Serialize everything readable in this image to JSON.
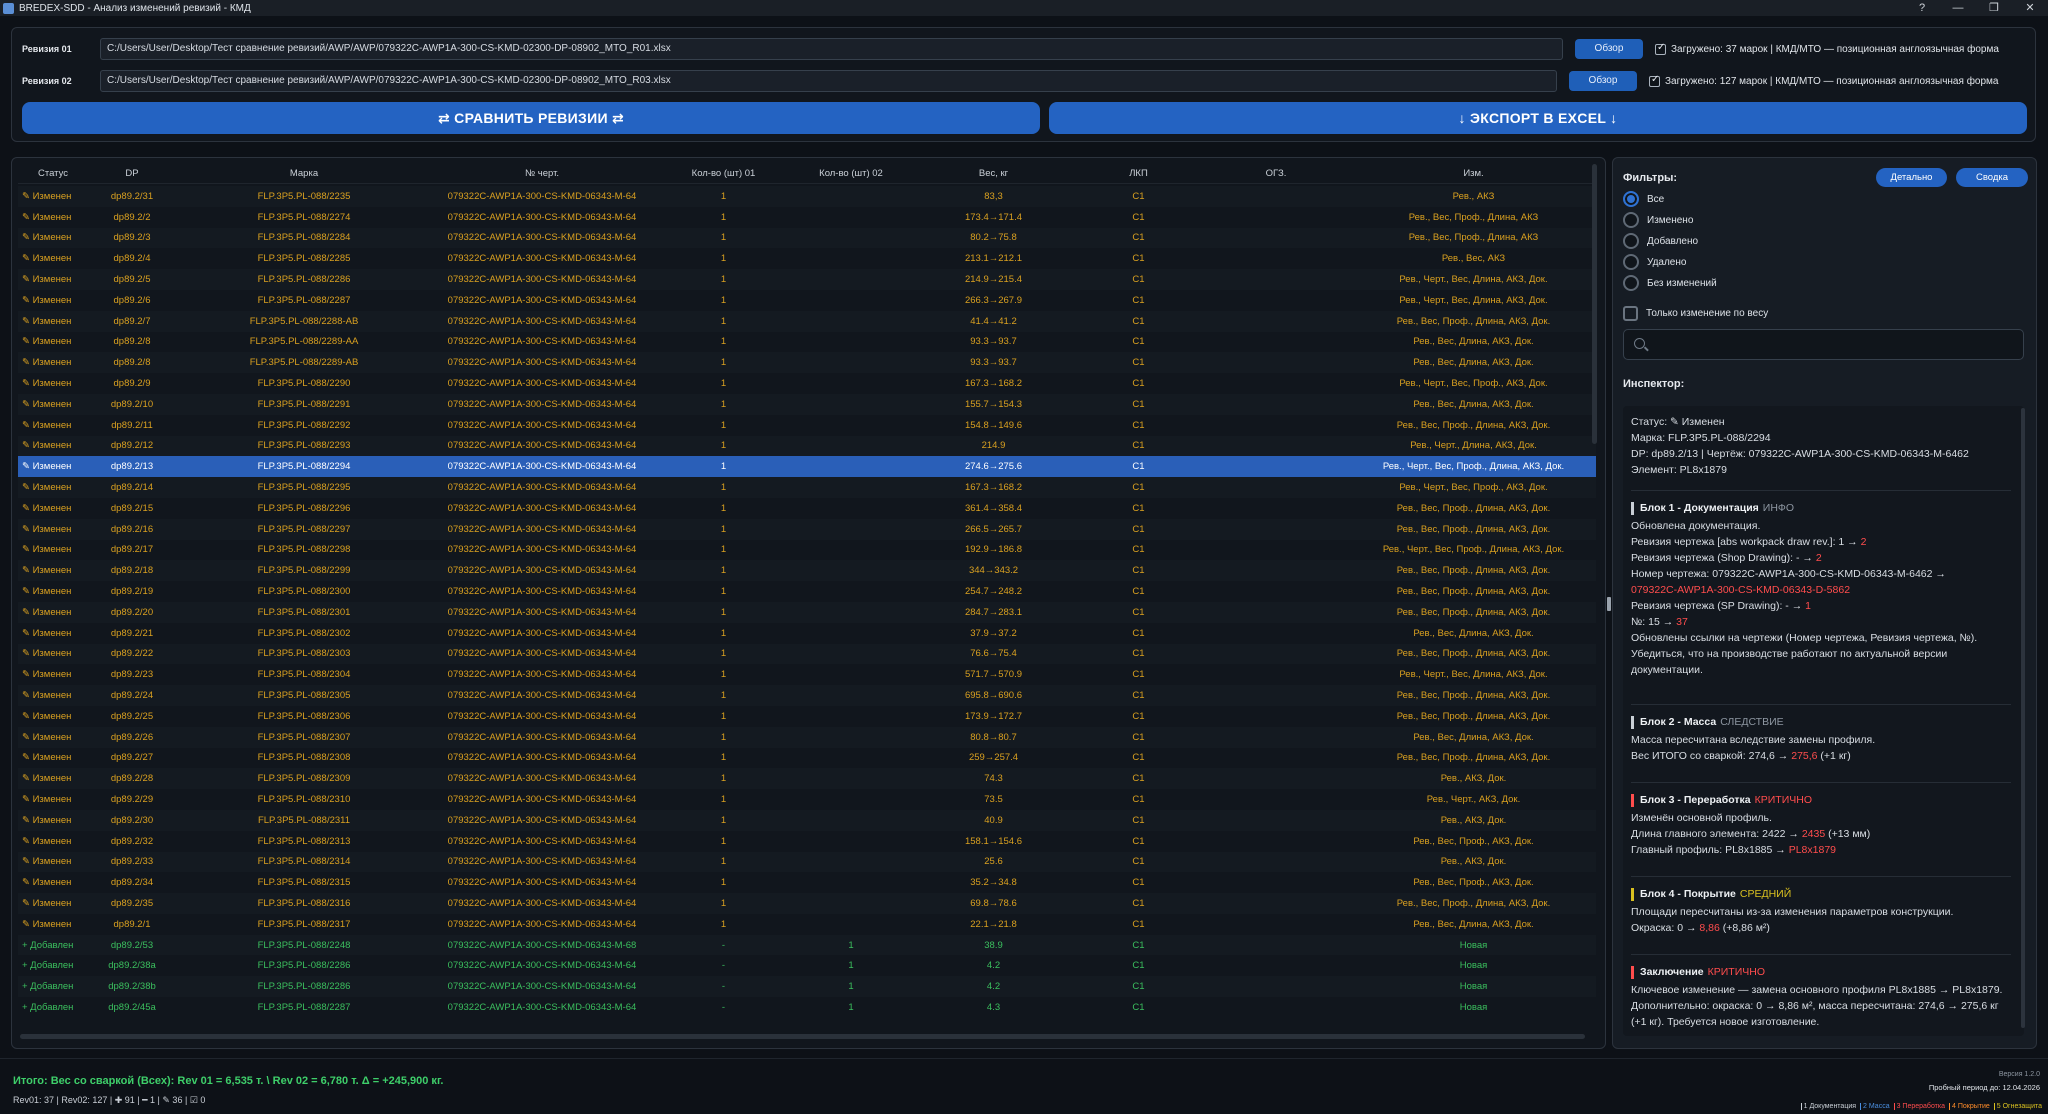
{
  "window": {
    "title": "BREDEX-SDD - Анализ изменений ревизий - КМД",
    "controls": [
      "?",
      "—",
      "❐",
      "✕"
    ]
  },
  "revisions": [
    {
      "label": "Ревизия 01",
      "path": "C:/Users/User/Desktop/Тест сравнение ревизий/AWP/AWP/079322C-AWP1A-300-CS-KMD-02300-DP-08902_MTO_R01.xlsx",
      "browse": "Обзор",
      "loaded": "Загружено: 37 марок | КМД/МТО — позиционная англоязычная форма"
    },
    {
      "label": "Ревизия 02",
      "path": "C:/Users/User/Desktop/Тест сравнение ревизий/AWP/AWP/079322C-AWP1A-300-CS-KMD-02300-DP-08902_MTO_R03.xlsx",
      "browse": "Обзор",
      "loaded": "Загружено: 127 марок | КМД/МТО — позиционная англоязычная форма"
    }
  ],
  "actions": {
    "compare": "⇄   СРАВНИТЬ РЕВИЗИИ   ⇄",
    "export": "↓   ЭКСПОРТ В EXCEL   ↓"
  },
  "table": {
    "headers": [
      "Статус",
      "DP",
      "Марка",
      "№ черт.",
      "Кол-во (шт) 01",
      "Кол-во (шт) 02",
      "Вес, кг",
      "ЛКП",
      "ОГЗ.",
      "Изм."
    ],
    "selected_index": 13,
    "rows": [
      {
        "status": "✎ Изменен",
        "kind": "changed",
        "dp": "dp89.2/31",
        "mark": "FLP.3P5.PL-088/2235",
        "drawing": "079322C-AWP1A-300-CS-KMD-06343-M-64",
        "q1": "1",
        "q2": "",
        "weight": "83,3",
        "lkp": "C1",
        "ogz": "",
        "chg": "Рев., АКЗ"
      },
      {
        "status": "✎ Изменен",
        "kind": "changed",
        "dp": "dp89.2/2",
        "mark": "FLP.3P5.PL-088/2274",
        "drawing": "079322C-AWP1A-300-CS-KMD-06343-M-64",
        "q1": "1",
        "q2": "",
        "weight": "173.4→171.4",
        "lkp": "C1",
        "ogz": "",
        "chg": "Рев., Вес, Проф., Длина, АКЗ"
      },
      {
        "status": "✎ Изменен",
        "kind": "changed",
        "dp": "dp89.2/3",
        "mark": "FLP.3P5.PL-088/2284",
        "drawing": "079322C-AWP1A-300-CS-KMD-06343-M-64",
        "q1": "1",
        "q2": "",
        "weight": "80.2→75.8",
        "lkp": "C1",
        "ogz": "",
        "chg": "Рев., Вес, Проф., Длина, АКЗ"
      },
      {
        "status": "✎ Изменен",
        "kind": "changed",
        "dp": "dp89.2/4",
        "mark": "FLP.3P5.PL-088/2285",
        "drawing": "079322C-AWP1A-300-CS-KMD-06343-M-64",
        "q1": "1",
        "q2": "",
        "weight": "213.1→212.1",
        "lkp": "C1",
        "ogz": "",
        "chg": "Рев., Вес, АКЗ"
      },
      {
        "status": "✎ Изменен",
        "kind": "changed",
        "dp": "dp89.2/5",
        "mark": "FLP.3P5.PL-088/2286",
        "drawing": "079322C-AWP1A-300-CS-KMD-06343-M-64",
        "q1": "1",
        "q2": "",
        "weight": "214.9→215.4",
        "lkp": "C1",
        "ogz": "",
        "chg": "Рев., Черт., Вес, Длина, АКЗ, Док."
      },
      {
        "status": "✎ Изменен",
        "kind": "changed",
        "dp": "dp89.2/6",
        "mark": "FLP.3P5.PL-088/2287",
        "drawing": "079322C-AWP1A-300-CS-KMD-06343-M-64",
        "q1": "1",
        "q2": "",
        "weight": "266.3→267.9",
        "lkp": "C1",
        "ogz": "",
        "chg": "Рев., Черт., Вес, Длина, АКЗ, Док."
      },
      {
        "status": "✎ Изменен",
        "kind": "changed",
        "dp": "dp89.2/7",
        "mark": "FLP.3P5.PL-088/2288-AB",
        "drawing": "079322C-AWP1A-300-CS-KMD-06343-M-64",
        "q1": "1",
        "q2": "",
        "weight": "41.4→41.2",
        "lkp": "C1",
        "ogz": "",
        "chg": "Рев., Вес, Проф., Длина, АКЗ, Док."
      },
      {
        "status": "✎ Изменен",
        "kind": "changed",
        "dp": "dp89.2/8",
        "mark": "FLP.3P5.PL-088/2289-AA",
        "drawing": "079322C-AWP1A-300-CS-KMD-06343-M-64",
        "q1": "1",
        "q2": "",
        "weight": "93.3→93.7",
        "lkp": "C1",
        "ogz": "",
        "chg": "Рев., Вес, Длина, АКЗ, Док."
      },
      {
        "status": "✎ Изменен",
        "kind": "changed",
        "dp": "dp89.2/8",
        "mark": "FLP.3P5.PL-088/2289-AB",
        "drawing": "079322C-AWP1A-300-CS-KMD-06343-M-64",
        "q1": "1",
        "q2": "",
        "weight": "93.3→93.7",
        "lkp": "C1",
        "ogz": "",
        "chg": "Рев., Вес, Длина, АКЗ, Док."
      },
      {
        "status": "✎ Изменен",
        "kind": "changed",
        "dp": "dp89.2/9",
        "mark": "FLP.3P5.PL-088/2290",
        "drawing": "079322C-AWP1A-300-CS-KMD-06343-M-64",
        "q1": "1",
        "q2": "",
        "weight": "167.3→168.2",
        "lkp": "C1",
        "ogz": "",
        "chg": "Рев., Черт., Вес, Проф., АКЗ, Док."
      },
      {
        "status": "✎ Изменен",
        "kind": "changed",
        "dp": "dp89.2/10",
        "mark": "FLP.3P5.PL-088/2291",
        "drawing": "079322C-AWP1A-300-CS-KMD-06343-M-64",
        "q1": "1",
        "q2": "",
        "weight": "155.7→154.3",
        "lkp": "C1",
        "ogz": "",
        "chg": "Рев., Вес, Длина, АКЗ, Док."
      },
      {
        "status": "✎ Изменен",
        "kind": "changed",
        "dp": "dp89.2/11",
        "mark": "FLP.3P5.PL-088/2292",
        "drawing": "079322C-AWP1A-300-CS-KMD-06343-M-64",
        "q1": "1",
        "q2": "",
        "weight": "154.8→149.6",
        "lkp": "C1",
        "ogz": "",
        "chg": "Рев., Вес, Проф., Длина, АКЗ, Док."
      },
      {
        "status": "✎ Изменен",
        "kind": "changed",
        "dp": "dp89.2/12",
        "mark": "FLP.3P5.PL-088/2293",
        "drawing": "079322C-AWP1A-300-CS-KMD-06343-M-64",
        "q1": "1",
        "q2": "",
        "weight": "214.9",
        "lkp": "C1",
        "ogz": "",
        "chg": "Рев., Черт., Длина, АКЗ, Док."
      },
      {
        "status": "✎ Изменен",
        "kind": "changed",
        "dp": "dp89.2/13",
        "mark": "FLP.3P5.PL-088/2294",
        "drawing": "079322C-AWP1A-300-CS-KMD-06343-M-64",
        "q1": "1",
        "q2": "",
        "weight": "274.6→275.6",
        "lkp": "C1",
        "ogz": "",
        "chg": "Рев., Черт., Вес, Проф., Длина, АКЗ, Док."
      },
      {
        "status": "✎ Изменен",
        "kind": "changed",
        "dp": "dp89.2/14",
        "mark": "FLP.3P5.PL-088/2295",
        "drawing": "079322C-AWP1A-300-CS-KMD-06343-M-64",
        "q1": "1",
        "q2": "",
        "weight": "167.3→168.2",
        "lkp": "C1",
        "ogz": "",
        "chg": "Рев., Черт., Вес, Проф., АКЗ, Док."
      },
      {
        "status": "✎ Изменен",
        "kind": "changed",
        "dp": "dp89.2/15",
        "mark": "FLP.3P5.PL-088/2296",
        "drawing": "079322C-AWP1A-300-CS-KMD-06343-M-64",
        "q1": "1",
        "q2": "",
        "weight": "361.4→358.4",
        "lkp": "C1",
        "ogz": "",
        "chg": "Рев., Вес, Проф., Длина, АКЗ, Док."
      },
      {
        "status": "✎ Изменен",
        "kind": "changed",
        "dp": "dp89.2/16",
        "mark": "FLP.3P5.PL-088/2297",
        "drawing": "079322C-AWP1A-300-CS-KMD-06343-M-64",
        "q1": "1",
        "q2": "",
        "weight": "266.5→265.7",
        "lkp": "C1",
        "ogz": "",
        "chg": "Рев., Вес, Проф., Длина, АКЗ, Док."
      },
      {
        "status": "✎ Изменен",
        "kind": "changed",
        "dp": "dp89.2/17",
        "mark": "FLP.3P5.PL-088/2298",
        "drawing": "079322C-AWP1A-300-CS-KMD-06343-M-64",
        "q1": "1",
        "q2": "",
        "weight": "192.9→186.8",
        "lkp": "C1",
        "ogz": "",
        "chg": "Рев., Черт., Вес, Проф., Длина, АКЗ, Док."
      },
      {
        "status": "✎ Изменен",
        "kind": "changed",
        "dp": "dp89.2/18",
        "mark": "FLP.3P5.PL-088/2299",
        "drawing": "079322C-AWP1A-300-CS-KMD-06343-M-64",
        "q1": "1",
        "q2": "",
        "weight": "344→343.2",
        "lkp": "C1",
        "ogz": "",
        "chg": "Рев., Вес, Проф., Длина, АКЗ, Док."
      },
      {
        "status": "✎ Изменен",
        "kind": "changed",
        "dp": "dp89.2/19",
        "mark": "FLP.3P5.PL-088/2300",
        "drawing": "079322C-AWP1A-300-CS-KMD-06343-M-64",
        "q1": "1",
        "q2": "",
        "weight": "254.7→248.2",
        "lkp": "C1",
        "ogz": "",
        "chg": "Рев., Вес, Проф., Длина, АКЗ, Док."
      },
      {
        "status": "✎ Изменен",
        "kind": "changed",
        "dp": "dp89.2/20",
        "mark": "FLP.3P5.PL-088/2301",
        "drawing": "079322C-AWP1A-300-CS-KMD-06343-M-64",
        "q1": "1",
        "q2": "",
        "weight": "284.7→283.1",
        "lkp": "C1",
        "ogz": "",
        "chg": "Рев., Вес, Проф., Длина, АКЗ, Док."
      },
      {
        "status": "✎ Изменен",
        "kind": "changed",
        "dp": "dp89.2/21",
        "mark": "FLP.3P5.PL-088/2302",
        "drawing": "079322C-AWP1A-300-CS-KMD-06343-M-64",
        "q1": "1",
        "q2": "",
        "weight": "37.9→37.2",
        "lkp": "C1",
        "ogz": "",
        "chg": "Рев., Вес, Длина, АКЗ, Док."
      },
      {
        "status": "✎ Изменен",
        "kind": "changed",
        "dp": "dp89.2/22",
        "mark": "FLP.3P5.PL-088/2303",
        "drawing": "079322C-AWP1A-300-CS-KMD-06343-M-64",
        "q1": "1",
        "q2": "",
        "weight": "76.6→75.4",
        "lkp": "C1",
        "ogz": "",
        "chg": "Рев., Вес, Проф., Длина, АКЗ, Док."
      },
      {
        "status": "✎ Изменен",
        "kind": "changed",
        "dp": "dp89.2/23",
        "mark": "FLP.3P5.PL-088/2304",
        "drawing": "079322C-AWP1A-300-CS-KMD-06343-M-64",
        "q1": "1",
        "q2": "",
        "weight": "571.7→570.9",
        "lkp": "C1",
        "ogz": "",
        "chg": "Рев., Черт., Вес, Длина, АКЗ, Док."
      },
      {
        "status": "✎ Изменен",
        "kind": "changed",
        "dp": "dp89.2/24",
        "mark": "FLP.3P5.PL-088/2305",
        "drawing": "079322C-AWP1A-300-CS-KMD-06343-M-64",
        "q1": "1",
        "q2": "",
        "weight": "695.8→690.6",
        "lkp": "C1",
        "ogz": "",
        "chg": "Рев., Вес, Проф., Длина, АКЗ, Док."
      },
      {
        "status": "✎ Изменен",
        "kind": "changed",
        "dp": "dp89.2/25",
        "mark": "FLP.3P5.PL-088/2306",
        "drawing": "079322C-AWP1A-300-CS-KMD-06343-M-64",
        "q1": "1",
        "q2": "",
        "weight": "173.9→172.7",
        "lkp": "C1",
        "ogz": "",
        "chg": "Рев., Вес, Проф., Длина, АКЗ, Док."
      },
      {
        "status": "✎ Изменен",
        "kind": "changed",
        "dp": "dp89.2/26",
        "mark": "FLP.3P5.PL-088/2307",
        "drawing": "079322C-AWP1A-300-CS-KMD-06343-M-64",
        "q1": "1",
        "q2": "",
        "weight": "80.8→80.7",
        "lkp": "C1",
        "ogz": "",
        "chg": "Рев., Вес, Длина, АКЗ, Док."
      },
      {
        "status": "✎ Изменен",
        "kind": "changed",
        "dp": "dp89.2/27",
        "mark": "FLP.3P5.PL-088/2308",
        "drawing": "079322C-AWP1A-300-CS-KMD-06343-M-64",
        "q1": "1",
        "q2": "",
        "weight": "259→257.4",
        "lkp": "C1",
        "ogz": "",
        "chg": "Рев., Вес, Проф., Длина, АКЗ, Док."
      },
      {
        "status": "✎ Изменен",
        "kind": "changed",
        "dp": "dp89.2/28",
        "mark": "FLP.3P5.PL-088/2309",
        "drawing": "079322C-AWP1A-300-CS-KMD-06343-M-64",
        "q1": "1",
        "q2": "",
        "weight": "74.3",
        "lkp": "C1",
        "ogz": "",
        "chg": "Рев., АКЗ, Док."
      },
      {
        "status": "✎ Изменен",
        "kind": "changed",
        "dp": "dp89.2/29",
        "mark": "FLP.3P5.PL-088/2310",
        "drawing": "079322C-AWP1A-300-CS-KMD-06343-M-64",
        "q1": "1",
        "q2": "",
        "weight": "73.5",
        "lkp": "C1",
        "ogz": "",
        "chg": "Рев., Черт., АКЗ, Док."
      },
      {
        "status": "✎ Изменен",
        "kind": "changed",
        "dp": "dp89.2/30",
        "mark": "FLP.3P5.PL-088/2311",
        "drawing": "079322C-AWP1A-300-CS-KMD-06343-M-64",
        "q1": "1",
        "q2": "",
        "weight": "40.9",
        "lkp": "C1",
        "ogz": "",
        "chg": "Рев., АКЗ, Док."
      },
      {
        "status": "✎ Изменен",
        "kind": "changed",
        "dp": "dp89.2/32",
        "mark": "FLP.3P5.PL-088/2313",
        "drawing": "079322C-AWP1A-300-CS-KMD-06343-M-64",
        "q1": "1",
        "q2": "",
        "weight": "158.1→154.6",
        "lkp": "C1",
        "ogz": "",
        "chg": "Рев., Вес, Проф., АКЗ, Док."
      },
      {
        "status": "✎ Изменен",
        "kind": "changed",
        "dp": "dp89.2/33",
        "mark": "FLP.3P5.PL-088/2314",
        "drawing": "079322C-AWP1A-300-CS-KMD-06343-M-64",
        "q1": "1",
        "q2": "",
        "weight": "25.6",
        "lkp": "C1",
        "ogz": "",
        "chg": "Рев., АКЗ, Док."
      },
      {
        "status": "✎ Изменен",
        "kind": "changed",
        "dp": "dp89.2/34",
        "mark": "FLP.3P5.PL-088/2315",
        "drawing": "079322C-AWP1A-300-CS-KMD-06343-M-64",
        "q1": "1",
        "q2": "",
        "weight": "35.2→34.8",
        "lkp": "C1",
        "ogz": "",
        "chg": "Рев., Вес, Проф., АКЗ, Док."
      },
      {
        "status": "✎ Изменен",
        "kind": "changed",
        "dp": "dp89.2/35",
        "mark": "FLP.3P5.PL-088/2316",
        "drawing": "079322C-AWP1A-300-CS-KMD-06343-M-64",
        "q1": "1",
        "q2": "",
        "weight": "69.8→78.6",
        "lkp": "C1",
        "ogz": "",
        "chg": "Рев., Вес, Проф., Длина, АКЗ, Док."
      },
      {
        "status": "✎ Изменен",
        "kind": "changed",
        "dp": "dp89.2/1",
        "mark": "FLP.3P5.PL-088/2317",
        "drawing": "079322C-AWP1A-300-CS-KMD-06343-M-64",
        "q1": "1",
        "q2": "",
        "weight": "22.1→21.8",
        "lkp": "C1",
        "ogz": "",
        "chg": "Рев., Вес, Длина, АКЗ, Док."
      },
      {
        "status": "+ Добавлен",
        "kind": "added",
        "dp": "dp89.2/53",
        "mark": "FLP.3P5.PL-088/2248",
        "drawing": "079322C-AWP1A-300-CS-KMD-06343-M-68",
        "q1": "-",
        "q2": "1",
        "weight": "38.9",
        "lkp": "C1",
        "ogz": "",
        "chg": "Новая"
      },
      {
        "status": "+ Добавлен",
        "kind": "added",
        "dp": "dp89.2/38a",
        "mark": "FLP.3P5.PL-088/2286",
        "drawing": "079322C-AWP1A-300-CS-KMD-06343-M-64",
        "q1": "-",
        "q2": "1",
        "weight": "4.2",
        "lkp": "C1",
        "ogz": "",
        "chg": "Новая"
      },
      {
        "status": "+ Добавлен",
        "kind": "added",
        "dp": "dp89.2/38b",
        "mark": "FLP.3P5.PL-088/2286",
        "drawing": "079322C-AWP1A-300-CS-KMD-06343-M-64",
        "q1": "-",
        "q2": "1",
        "weight": "4.2",
        "lkp": "C1",
        "ogz": "",
        "chg": "Новая"
      },
      {
        "status": "+ Добавлен",
        "kind": "added",
        "dp": "dp89.2/45a",
        "mark": "FLP.3P5.PL-088/2287",
        "drawing": "079322C-AWP1A-300-CS-KMD-06343-M-64",
        "q1": "-",
        "q2": "1",
        "weight": "4.3",
        "lkp": "C1",
        "ogz": "",
        "chg": "Новая"
      }
    ]
  },
  "filters": {
    "title": "Фильтры:",
    "detail_btn": "Детально",
    "summary_btn": "Сводка",
    "options": [
      "Все",
      "Изменено",
      "Добавлено",
      "Удалено",
      "Без изменений"
    ],
    "selected": "Все",
    "weight_only": "Только изменение по весу",
    "search_placeholder": ""
  },
  "inspector": {
    "title": "Инспектор:",
    "status_line": "Статус: ✎ Изменен",
    "mark_line": "Марка: FLP.3P5.PL-088/2294",
    "dp_line": "DP: dp89.2/13  |  Чертёж: 079322C-AWP1A-300-CS-KMD-06343-M-6462",
    "element_line": "Элемент: PL8x1879",
    "b1_title": "Блок 1 - Документация",
    "b1_tag": "ИНФО",
    "b1_l1": "Обновлена документация.",
    "b1_l2": "Ревизия чертежа [abs workpack draw rev.]: 1 → ",
    "b1_l2v": "2",
    "b1_l3": "Ревизия чертежа (Shop Drawing): - → ",
    "b1_l3v": "2",
    "b1_l4": "Номер чертежа: 079322C-AWP1A-300-CS-KMD-06343-M-6462 →",
    "b1_l4v": "079322C-AWP1A-300-CS-KMD-06343-D-5862",
    "b1_l5": "Ревизия чертежа (SP Drawing): - → ",
    "b1_l5v": "1",
    "b1_l6": "№: 15 → ",
    "b1_l6v": "37",
    "b1_l7": "Обновлены ссылки на чертежи (Номер чертежа, Ревизия чертежа, №). Убедиться, что на производстве работают по актуальной версии документации.",
    "b2_title": "Блок 2 - Масса",
    "b2_tag": "СЛЕДСТВИЕ",
    "b2_l1": "Масса пересчитана вследствие замены профиля.",
    "b2_l2": "Вес ИТОГО со сваркой: 274,6 → ",
    "b2_l2v": "275,6",
    "b2_l2s": " (+1 кг)",
    "b3_title": "Блок 3 - Переработка",
    "b3_tag": "КРИТИЧНО",
    "b3_l1": "Изменён основной профиль.",
    "b3_l2": "Длина главного элемента: 2422 → ",
    "b3_l2v": "2435",
    "b3_l2s": " (+13 мм)",
    "b3_l3": "Главный профиль: PL8x1885 → ",
    "b3_l3v": "PL8x1879",
    "b4_title": "Блок 4 - Покрытие",
    "b4_tag": "СРЕДНИЙ",
    "b4_l1": "Площади пересчитаны из-за изменения параметров конструкции.",
    "b4_l2": "Окраска: 0 → ",
    "b4_l2v": "8,86",
    "b4_l2s": " (+8,86 м²)",
    "b5_title": "Заключение",
    "b5_tag": "КРИТИЧНО",
    "b5_l1": "Ключевое изменение — замена основного профиля PL8x1885 → PL8x1879. Дополнительно: окраска: 0 → 8,86 м², масса пересчитана: 274,6 → 275,6 кг (+1 кг). Требуется новое изготовление."
  },
  "footer": {
    "total": "Итого: Вес со сваркой (Всех): Rev 01 = 6,535 т.  \\ Rev 02 = 6,780 т.  Δ = +245,900 кг.",
    "counts": "Rev01: 37 | Rev02: 127 | ✚ 91 | ━ 1 | ✎ 36 | ☑ 0",
    "version": "Версия 1.2.0",
    "trial": "Пробный период до: 12.04.2026",
    "legend": [
      "1 Документация",
      "2 Масса",
      "3 Переработка",
      "4 Покрытие",
      "5 Огнезащита"
    ]
  },
  "colors": {
    "changed": "#d9a020",
    "added": "#3bbf5e",
    "accent": "#2463c2",
    "critical": "#ff4d4d",
    "info": "#8d96a1",
    "medium": "#d9c020"
  }
}
